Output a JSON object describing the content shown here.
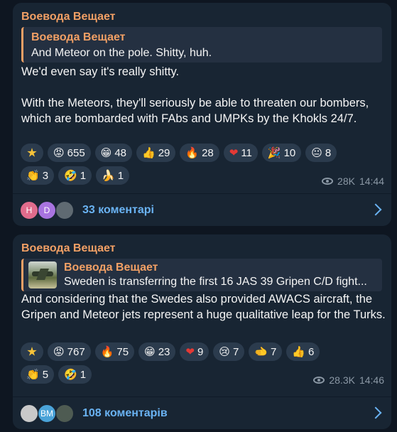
{
  "posts": [
    {
      "author": "Воевода Вещает",
      "quote": {
        "author": "Воевода Вещает",
        "text": "And Meteor on the pole.  Shitty, huh."
      },
      "body": [
        "We'd even say it's really shitty.",
        "",
        "With the Meteors, they'll seriously be able to threaten our bombers, which are bombarded with FAbs and UMPKs by the Khokls 24/7."
      ],
      "reactions_row1": [
        {
          "emoji": "",
          "count": "",
          "icon": "star-icon"
        },
        {
          "emoji": "😡",
          "count": "655",
          "icon": "angry-face-icon"
        },
        {
          "emoji": "😁",
          "count": "48",
          "icon": "grin-icon"
        },
        {
          "emoji": "👍",
          "count": "29",
          "icon": "thumbs-up-icon"
        },
        {
          "emoji": "🔥",
          "count": "28",
          "icon": "fire-icon"
        },
        {
          "emoji": "❤",
          "count": "11",
          "icon": "heart-icon"
        },
        {
          "emoji": "🎉",
          "count": "10",
          "icon": "party-icon"
        },
        {
          "emoji": "😐",
          "count": "8",
          "icon": "neutral-face-icon"
        }
      ],
      "reactions_row2": [
        {
          "emoji": "👏",
          "count": "3",
          "icon": "clap-icon"
        },
        {
          "emoji": "🤣",
          "count": "1",
          "icon": "rofl-icon"
        },
        {
          "emoji": "🍌",
          "count": "1",
          "icon": "banana-icon"
        }
      ],
      "views": "28K",
      "time": "14:44",
      "avatars": [
        {
          "label": "H",
          "color": "#e06c8c"
        },
        {
          "label": "D",
          "color": "#a874e0"
        },
        {
          "label": "",
          "color": "#5f6a72"
        }
      ],
      "comments": "33 коментарі"
    },
    {
      "author": "Воевода Вещает",
      "quote": {
        "author": "Воевода Вещает",
        "text": "Sweden is transferring the first 16 JAS 39 Gripen C/D fight..."
      },
      "body": [
        "And considering that the Swedes also provided AWACS aircraft, the Gripen and Meteor jets represent a huge qualitative leap for the Turks."
      ],
      "reactions_row1": [
        {
          "emoji": "",
          "count": "",
          "icon": "star-icon"
        },
        {
          "emoji": "😡",
          "count": "767",
          "icon": "angry-face-icon"
        },
        {
          "emoji": "🔥",
          "count": "75",
          "icon": "fire-icon"
        },
        {
          "emoji": "😁",
          "count": "23",
          "icon": "grin-icon"
        },
        {
          "emoji": "❤",
          "count": "9",
          "icon": "heart-icon"
        },
        {
          "emoji": "😢",
          "count": "7",
          "icon": "crying-face-icon"
        },
        {
          "emoji": "🫲",
          "count": "7",
          "icon": "hand-icon"
        },
        {
          "emoji": "👍",
          "count": "6",
          "icon": "thumbs-up-icon"
        }
      ],
      "reactions_row2": [
        {
          "emoji": "👏",
          "count": "5",
          "icon": "clap-icon"
        },
        {
          "emoji": "🤣",
          "count": "1",
          "icon": "rofl-icon"
        }
      ],
      "views": "28.3K",
      "time": "14:46",
      "avatars": [
        {
          "label": "",
          "color": "#c9c9c9"
        },
        {
          "label": "ВМ",
          "color": "#4aa3d8"
        },
        {
          "label": "",
          "color": "#4e5b52"
        }
      ],
      "comments": "108 коментарів"
    }
  ],
  "colors": {
    "background": "#0e1621",
    "bubble": "#182533",
    "accent": "#f2a065",
    "link": "#6ab3f3",
    "meta": "#8b98a5"
  }
}
